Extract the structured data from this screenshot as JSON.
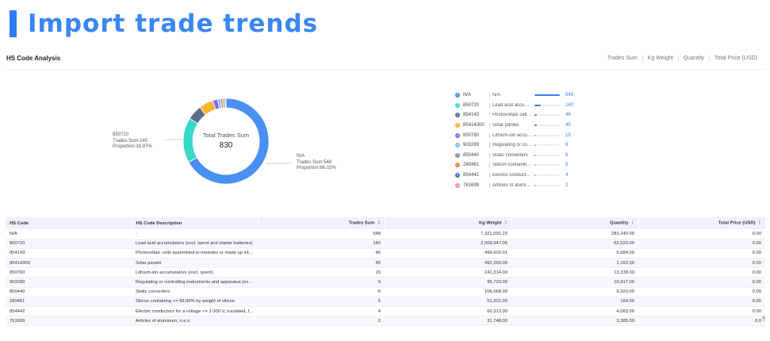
{
  "header": {
    "title": "Import trade trends"
  },
  "section": {
    "title": "HS Code Analysis",
    "tabs": [
      {
        "label": "Trades Sum",
        "active": true
      },
      {
        "label": "Kg Weight",
        "active": false
      },
      {
        "label": "Quantity",
        "active": false
      },
      {
        "label": "Total Price (USD)",
        "active": false
      }
    ]
  },
  "donut": {
    "center_label": "Total Trades Sum",
    "center_value": "830",
    "callout_left": {
      "code": "850720",
      "line1": "Trades Sum:140",
      "line2": "Proportion:16.87%"
    },
    "callout_right": {
      "code": "N/A",
      "line1": "Trades Sum:548",
      "line2": "Proportion:66.02%"
    }
  },
  "colors": {
    "accent": "#2f7cf6",
    "slices": [
      "#4a8ff4",
      "#38d9c8",
      "#5a6e8f",
      "#f5b536",
      "#7b6cf0",
      "#7fc3f5",
      "#8b959f",
      "#f07a3c",
      "#3f78c9",
      "#f08a9a"
    ]
  },
  "legend": [
    {
      "index": "1",
      "code": "N/A",
      "desc": "N/A",
      "value": "548",
      "fraction": 1.0
    },
    {
      "index": "2",
      "code": "850720",
      "desc": "Lead acid accumula...",
      "value": "140",
      "fraction": 0.255
    },
    {
      "index": "3",
      "code": "854143",
      "desc": "Photovoltaic cells a...",
      "value": "46",
      "fraction": 0.084
    },
    {
      "index": "4",
      "code": "85414300",
      "desc": "Solar panels",
      "value": "45",
      "fraction": 0.082
    },
    {
      "index": "5",
      "code": "850760",
      "desc": "Lithium-ion accum...",
      "value": "15",
      "fraction": 0.027
    },
    {
      "index": "6",
      "code": "903289",
      "desc": "Regulating or contr...",
      "value": "9",
      "fraction": 0.016
    },
    {
      "index": "7",
      "code": "850440",
      "desc": "Static converters",
      "value": "6",
      "fraction": 0.011
    },
    {
      "index": "8",
      "code": "280461",
      "desc": "Silicon containing >...",
      "value": "5",
      "fraction": 0.009
    },
    {
      "index": "9",
      "code": "854442",
      "desc": "Electric conductors ...",
      "value": "4",
      "fraction": 0.007
    },
    {
      "index": "10",
      "code": "761699",
      "desc": "Articles of aluminu...",
      "value": "2",
      "fraction": 0.004
    }
  ],
  "table": {
    "columns": [
      "HS Code",
      "HS Code Description",
      "Trades Sum",
      "Kg Weight",
      "Quantity",
      "Total Price (USD)"
    ],
    "rows": [
      [
        "N/A",
        "-",
        "548",
        "7,321,092.23",
        "283,240.00",
        "0.00"
      ],
      [
        "850720",
        "Lead acid accumulators (excl. spent and starter batteries)",
        "140",
        "2,009,947.06",
        "62,520.00",
        "0.00"
      ],
      [
        "854143",
        "Photovoltaic cells assembled in modules or made up into pan...",
        "46",
        "499,600.01",
        "5,684.00",
        "0.00"
      ],
      [
        "85414300",
        "Solar panels",
        "45",
        "492,260.00",
        "1,162.00",
        "0.00"
      ],
      [
        "850760",
        "Lithium-ion accumulators (excl. spent)",
        "15",
        "241,314.00",
        "13,338.00",
        "0.00"
      ],
      [
        "903289",
        "Regulating or controlling instruments and apparatus (excl. hy...",
        "9",
        "95,720.00",
        "10,917.00",
        "0.00"
      ],
      [
        "850440",
        "Static converters",
        "6",
        "106,068.00",
        "9,323.00",
        "0.00"
      ],
      [
        "280461",
        "Silicon containing >= 99,99% by weight of silicon",
        "5",
        "51,201.00",
        "164.00",
        "0.00"
      ],
      [
        "854442",
        "Electric conductors for a voltage <= 1 000 V, insulated, fitted w...",
        "4",
        "60,312.00",
        "4,083.00",
        "0.00"
      ],
      [
        "761699",
        "Articles of aluminum, n.e.s.",
        "2",
        "31,748.00",
        "3,385.00",
        "0.0"
      ]
    ]
  },
  "scroll_icon": "arrow-up-icon"
}
